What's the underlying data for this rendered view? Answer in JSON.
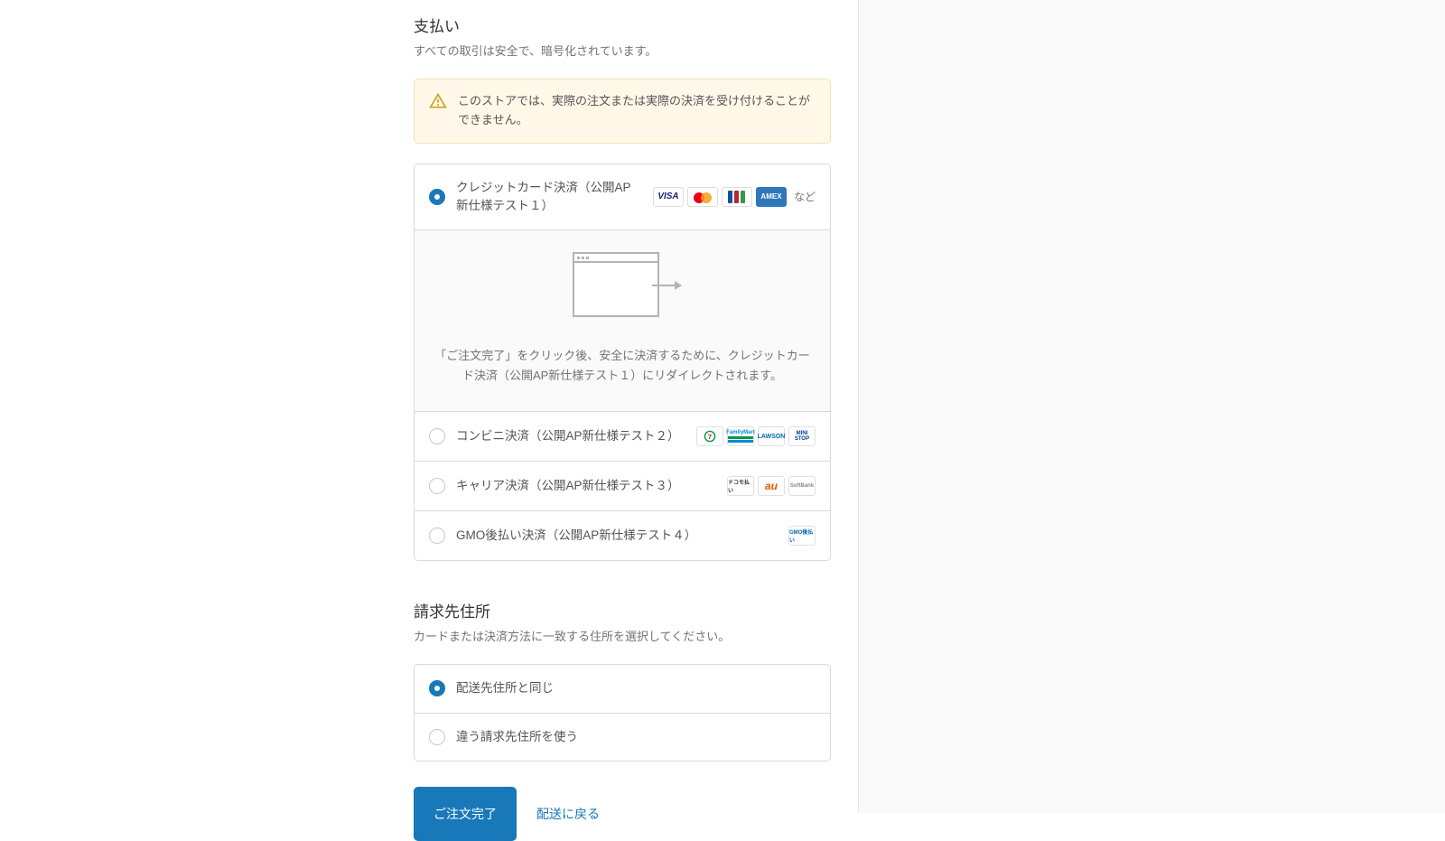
{
  "payment": {
    "title": "支払い",
    "subtitle": "すべての取引は安全で、暗号化されています。",
    "notice": "このストアでは、実際の注文または実際の決済を受け付けることができません。",
    "methods": [
      {
        "label": "クレジットカード決済（公開AP新仕様テスト１）",
        "selected": true,
        "badges": [
          "visa",
          "mastercard",
          "jcb",
          "amex"
        ],
        "etc": "など",
        "expand_text": "「ご注文完了」をクリック後、安全に決済するために、クレジットカード決済（公開AP新仕様テスト１）にリダイレクトされます。"
      },
      {
        "label": "コンビニ決済（公開AP新仕様テスト２）",
        "selected": false,
        "badges": [
          "seven",
          "familymart",
          "lawson",
          "ministop"
        ]
      },
      {
        "label": "キャリア決済（公開AP新仕様テスト３）",
        "selected": false,
        "badges": [
          "docomo",
          "au",
          "softbank"
        ]
      },
      {
        "label": "GMO後払い決済（公開AP新仕様テスト４）",
        "selected": false,
        "badges": [
          "gmo"
        ]
      }
    ]
  },
  "billing": {
    "title": "請求先住所",
    "subtitle": "カードまたは決済方法に一致する住所を選択してください。",
    "options": [
      {
        "label": "配送先住所と同じ",
        "selected": true
      },
      {
        "label": "違う請求先住所を使う",
        "selected": false
      }
    ]
  },
  "actions": {
    "complete": "ご注文完了",
    "back": "配送に戻る"
  },
  "badge_text": {
    "visa": "VISA",
    "amex": "AMEX",
    "familymart": "FamilyMart",
    "lawson": "LAWSON",
    "ministop": "MINI STOP",
    "docomo": "ドコモ払い",
    "au": "au",
    "softbank": "SoftBank",
    "gmo": "GMO後払い"
  }
}
